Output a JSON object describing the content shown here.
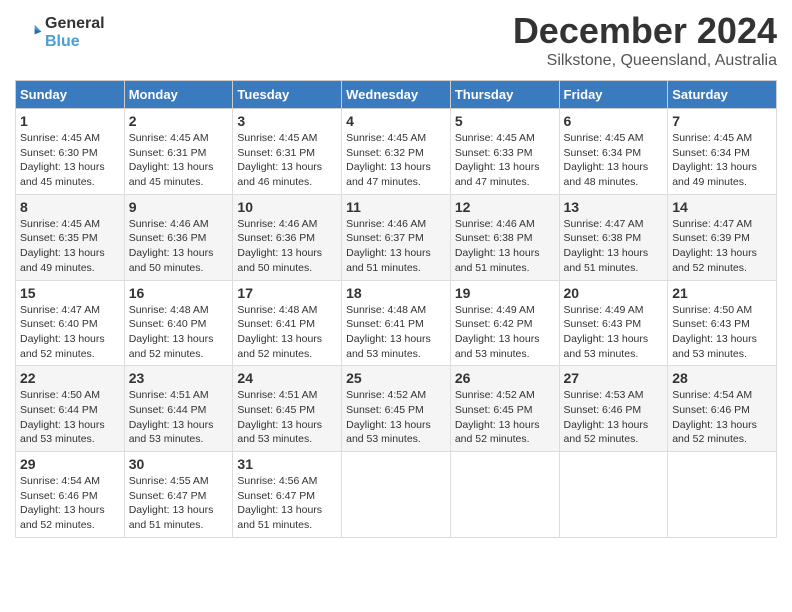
{
  "header": {
    "logo_line1": "General",
    "logo_line2": "Blue",
    "month_title": "December 2024",
    "location": "Silkstone, Queensland, Australia"
  },
  "days_of_week": [
    "Sunday",
    "Monday",
    "Tuesday",
    "Wednesday",
    "Thursday",
    "Friday",
    "Saturday"
  ],
  "weeks": [
    [
      {
        "day": "1",
        "sunrise": "4:45 AM",
        "sunset": "6:30 PM",
        "daylight": "13 hours and 45 minutes."
      },
      {
        "day": "2",
        "sunrise": "4:45 AM",
        "sunset": "6:31 PM",
        "daylight": "13 hours and 45 minutes."
      },
      {
        "day": "3",
        "sunrise": "4:45 AM",
        "sunset": "6:31 PM",
        "daylight": "13 hours and 46 minutes."
      },
      {
        "day": "4",
        "sunrise": "4:45 AM",
        "sunset": "6:32 PM",
        "daylight": "13 hours and 47 minutes."
      },
      {
        "day": "5",
        "sunrise": "4:45 AM",
        "sunset": "6:33 PM",
        "daylight": "13 hours and 47 minutes."
      },
      {
        "day": "6",
        "sunrise": "4:45 AM",
        "sunset": "6:34 PM",
        "daylight": "13 hours and 48 minutes."
      },
      {
        "day": "7",
        "sunrise": "4:45 AM",
        "sunset": "6:34 PM",
        "daylight": "13 hours and 49 minutes."
      }
    ],
    [
      {
        "day": "8",
        "sunrise": "4:45 AM",
        "sunset": "6:35 PM",
        "daylight": "13 hours and 49 minutes."
      },
      {
        "day": "9",
        "sunrise": "4:46 AM",
        "sunset": "6:36 PM",
        "daylight": "13 hours and 50 minutes."
      },
      {
        "day": "10",
        "sunrise": "4:46 AM",
        "sunset": "6:36 PM",
        "daylight": "13 hours and 50 minutes."
      },
      {
        "day": "11",
        "sunrise": "4:46 AM",
        "sunset": "6:37 PM",
        "daylight": "13 hours and 51 minutes."
      },
      {
        "day": "12",
        "sunrise": "4:46 AM",
        "sunset": "6:38 PM",
        "daylight": "13 hours and 51 minutes."
      },
      {
        "day": "13",
        "sunrise": "4:47 AM",
        "sunset": "6:38 PM",
        "daylight": "13 hours and 51 minutes."
      },
      {
        "day": "14",
        "sunrise": "4:47 AM",
        "sunset": "6:39 PM",
        "daylight": "13 hours and 52 minutes."
      }
    ],
    [
      {
        "day": "15",
        "sunrise": "4:47 AM",
        "sunset": "6:40 PM",
        "daylight": "13 hours and 52 minutes."
      },
      {
        "day": "16",
        "sunrise": "4:48 AM",
        "sunset": "6:40 PM",
        "daylight": "13 hours and 52 minutes."
      },
      {
        "day": "17",
        "sunrise": "4:48 AM",
        "sunset": "6:41 PM",
        "daylight": "13 hours and 52 minutes."
      },
      {
        "day": "18",
        "sunrise": "4:48 AM",
        "sunset": "6:41 PM",
        "daylight": "13 hours and 53 minutes."
      },
      {
        "day": "19",
        "sunrise": "4:49 AM",
        "sunset": "6:42 PM",
        "daylight": "13 hours and 53 minutes."
      },
      {
        "day": "20",
        "sunrise": "4:49 AM",
        "sunset": "6:43 PM",
        "daylight": "13 hours and 53 minutes."
      },
      {
        "day": "21",
        "sunrise": "4:50 AM",
        "sunset": "6:43 PM",
        "daylight": "13 hours and 53 minutes."
      }
    ],
    [
      {
        "day": "22",
        "sunrise": "4:50 AM",
        "sunset": "6:44 PM",
        "daylight": "13 hours and 53 minutes."
      },
      {
        "day": "23",
        "sunrise": "4:51 AM",
        "sunset": "6:44 PM",
        "daylight": "13 hours and 53 minutes."
      },
      {
        "day": "24",
        "sunrise": "4:51 AM",
        "sunset": "6:45 PM",
        "daylight": "13 hours and 53 minutes."
      },
      {
        "day": "25",
        "sunrise": "4:52 AM",
        "sunset": "6:45 PM",
        "daylight": "13 hours and 53 minutes."
      },
      {
        "day": "26",
        "sunrise": "4:52 AM",
        "sunset": "6:45 PM",
        "daylight": "13 hours and 52 minutes."
      },
      {
        "day": "27",
        "sunrise": "4:53 AM",
        "sunset": "6:46 PM",
        "daylight": "13 hours and 52 minutes."
      },
      {
        "day": "28",
        "sunrise": "4:54 AM",
        "sunset": "6:46 PM",
        "daylight": "13 hours and 52 minutes."
      }
    ],
    [
      {
        "day": "29",
        "sunrise": "4:54 AM",
        "sunset": "6:46 PM",
        "daylight": "13 hours and 52 minutes."
      },
      {
        "day": "30",
        "sunrise": "4:55 AM",
        "sunset": "6:47 PM",
        "daylight": "13 hours and 51 minutes."
      },
      {
        "day": "31",
        "sunrise": "4:56 AM",
        "sunset": "6:47 PM",
        "daylight": "13 hours and 51 minutes."
      },
      {
        "day": "",
        "sunrise": "",
        "sunset": "",
        "daylight": ""
      },
      {
        "day": "",
        "sunrise": "",
        "sunset": "",
        "daylight": ""
      },
      {
        "day": "",
        "sunrise": "",
        "sunset": "",
        "daylight": ""
      },
      {
        "day": "",
        "sunrise": "",
        "sunset": "",
        "daylight": ""
      }
    ]
  ]
}
